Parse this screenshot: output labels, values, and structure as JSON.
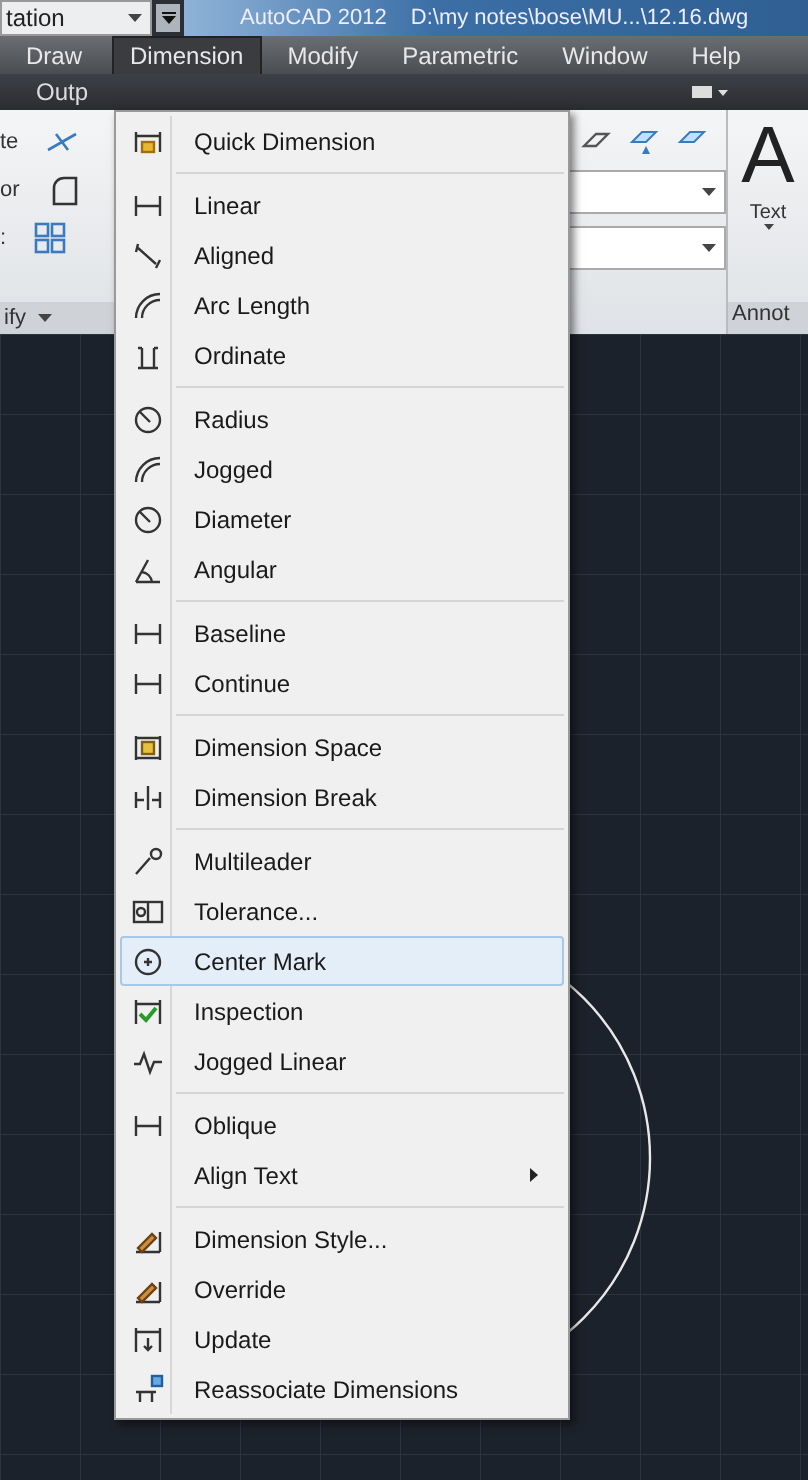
{
  "window": {
    "workspace": "tation",
    "app": "AutoCAD 2012",
    "file": "D:\\my notes\\bose\\MU...\\12.16.dwg"
  },
  "menu_bar": [
    {
      "label": "Draw",
      "selected": false
    },
    {
      "label": "Dimension",
      "selected": true
    },
    {
      "label": "Modify",
      "selected": false
    },
    {
      "label": "Parametric",
      "selected": false
    },
    {
      "label": "Window",
      "selected": false
    },
    {
      "label": "Help",
      "selected": false
    }
  ],
  "ribbon": {
    "tab": "Outp",
    "left_labels": [
      "te",
      "or",
      ":"
    ],
    "left_panel": "ify",
    "glyph": "A",
    "text_button": "Text",
    "right_panel": "Annot"
  },
  "dropdown": {
    "groups": [
      [
        {
          "label": "Quick Dimension",
          "kind": "quick",
          "selected": false,
          "submenu": false
        }
      ],
      [
        {
          "label": "Linear",
          "kind": "bracket",
          "selected": false,
          "submenu": false
        },
        {
          "label": "Aligned",
          "kind": "aligned",
          "selected": false,
          "submenu": false
        },
        {
          "label": "Arc Length",
          "kind": "arc",
          "selected": false,
          "submenu": false
        },
        {
          "label": "Ordinate",
          "kind": "ordinate",
          "selected": false,
          "submenu": false
        }
      ],
      [
        {
          "label": "Radius",
          "kind": "circle",
          "selected": false,
          "submenu": false
        },
        {
          "label": "Jogged",
          "kind": "arc",
          "selected": false,
          "submenu": false
        },
        {
          "label": "Diameter",
          "kind": "circle",
          "selected": false,
          "submenu": false
        },
        {
          "label": "Angular",
          "kind": "angle",
          "selected": false,
          "submenu": false
        }
      ],
      [
        {
          "label": "Baseline",
          "kind": "bracket",
          "selected": false,
          "submenu": false
        },
        {
          "label": "Continue",
          "kind": "bracket",
          "selected": false,
          "submenu": false
        }
      ],
      [
        {
          "label": "Dimension Space",
          "kind": "space",
          "selected": false,
          "submenu": false
        },
        {
          "label": "Dimension Break",
          "kind": "break",
          "selected": false,
          "submenu": false
        }
      ],
      [
        {
          "label": "Multileader",
          "kind": "leader",
          "selected": false,
          "submenu": false
        },
        {
          "label": "Tolerance...",
          "kind": "tolerance",
          "selected": false,
          "submenu": false
        },
        {
          "label": "Center Mark",
          "kind": "center",
          "selected": true,
          "submenu": false
        },
        {
          "label": "Inspection",
          "kind": "check",
          "selected": false,
          "submenu": false
        },
        {
          "label": "Jogged Linear",
          "kind": "zigzag",
          "selected": false,
          "submenu": false
        }
      ],
      [
        {
          "label": "Oblique",
          "kind": "bracket",
          "selected": false,
          "submenu": false
        },
        {
          "label": "Align Text",
          "kind": "none",
          "selected": false,
          "submenu": true
        }
      ],
      [
        {
          "label": "Dimension Style...",
          "kind": "pen",
          "selected": false,
          "submenu": false
        },
        {
          "label": "Override",
          "kind": "pen",
          "selected": false,
          "submenu": false
        },
        {
          "label": "Update",
          "kind": "update",
          "selected": false,
          "submenu": false
        },
        {
          "label": "Reassociate Dimensions",
          "kind": "reassoc",
          "selected": false,
          "submenu": false
        }
      ]
    ]
  }
}
